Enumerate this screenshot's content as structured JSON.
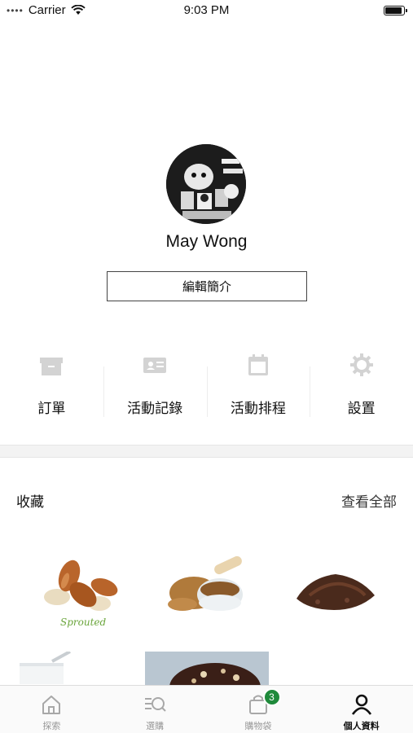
{
  "status_bar": {
    "carrier": "Carrier",
    "time": "9:03 PM",
    "icons": [
      "signal-dots-icon",
      "wifi-icon",
      "battery-icon"
    ]
  },
  "profile": {
    "name": "May Wong",
    "edit_button_label": "編輯簡介"
  },
  "quick_menu": {
    "items": [
      {
        "label": "訂單",
        "icon": "archive-box-icon"
      },
      {
        "label": "活動記錄",
        "icon": "id-card-icon"
      },
      {
        "label": "活動排程",
        "icon": "calendar-icon"
      },
      {
        "label": "設置",
        "icon": "gear-icon"
      }
    ]
  },
  "favorites": {
    "title": "收藏",
    "view_all_label": "查看全部",
    "products": [
      {
        "name": "almonds",
        "brand_logo": "Sprouted"
      },
      {
        "name": "flaxseed"
      },
      {
        "name": "cacao-nibs"
      },
      {
        "name": "coconut-oil"
      },
      {
        "name": "chocolate-donut"
      }
    ]
  },
  "tab_bar": {
    "tabs": [
      {
        "label": "探索",
        "icon": "home-icon",
        "active": false
      },
      {
        "label": "選購",
        "icon": "search-list-icon",
        "active": false
      },
      {
        "label": "購物袋",
        "icon": "shopping-bag-icon",
        "active": false,
        "badge": "3"
      },
      {
        "label": "個人資料",
        "icon": "person-icon",
        "active": true
      }
    ],
    "badge_color": "#1f8a3b"
  }
}
